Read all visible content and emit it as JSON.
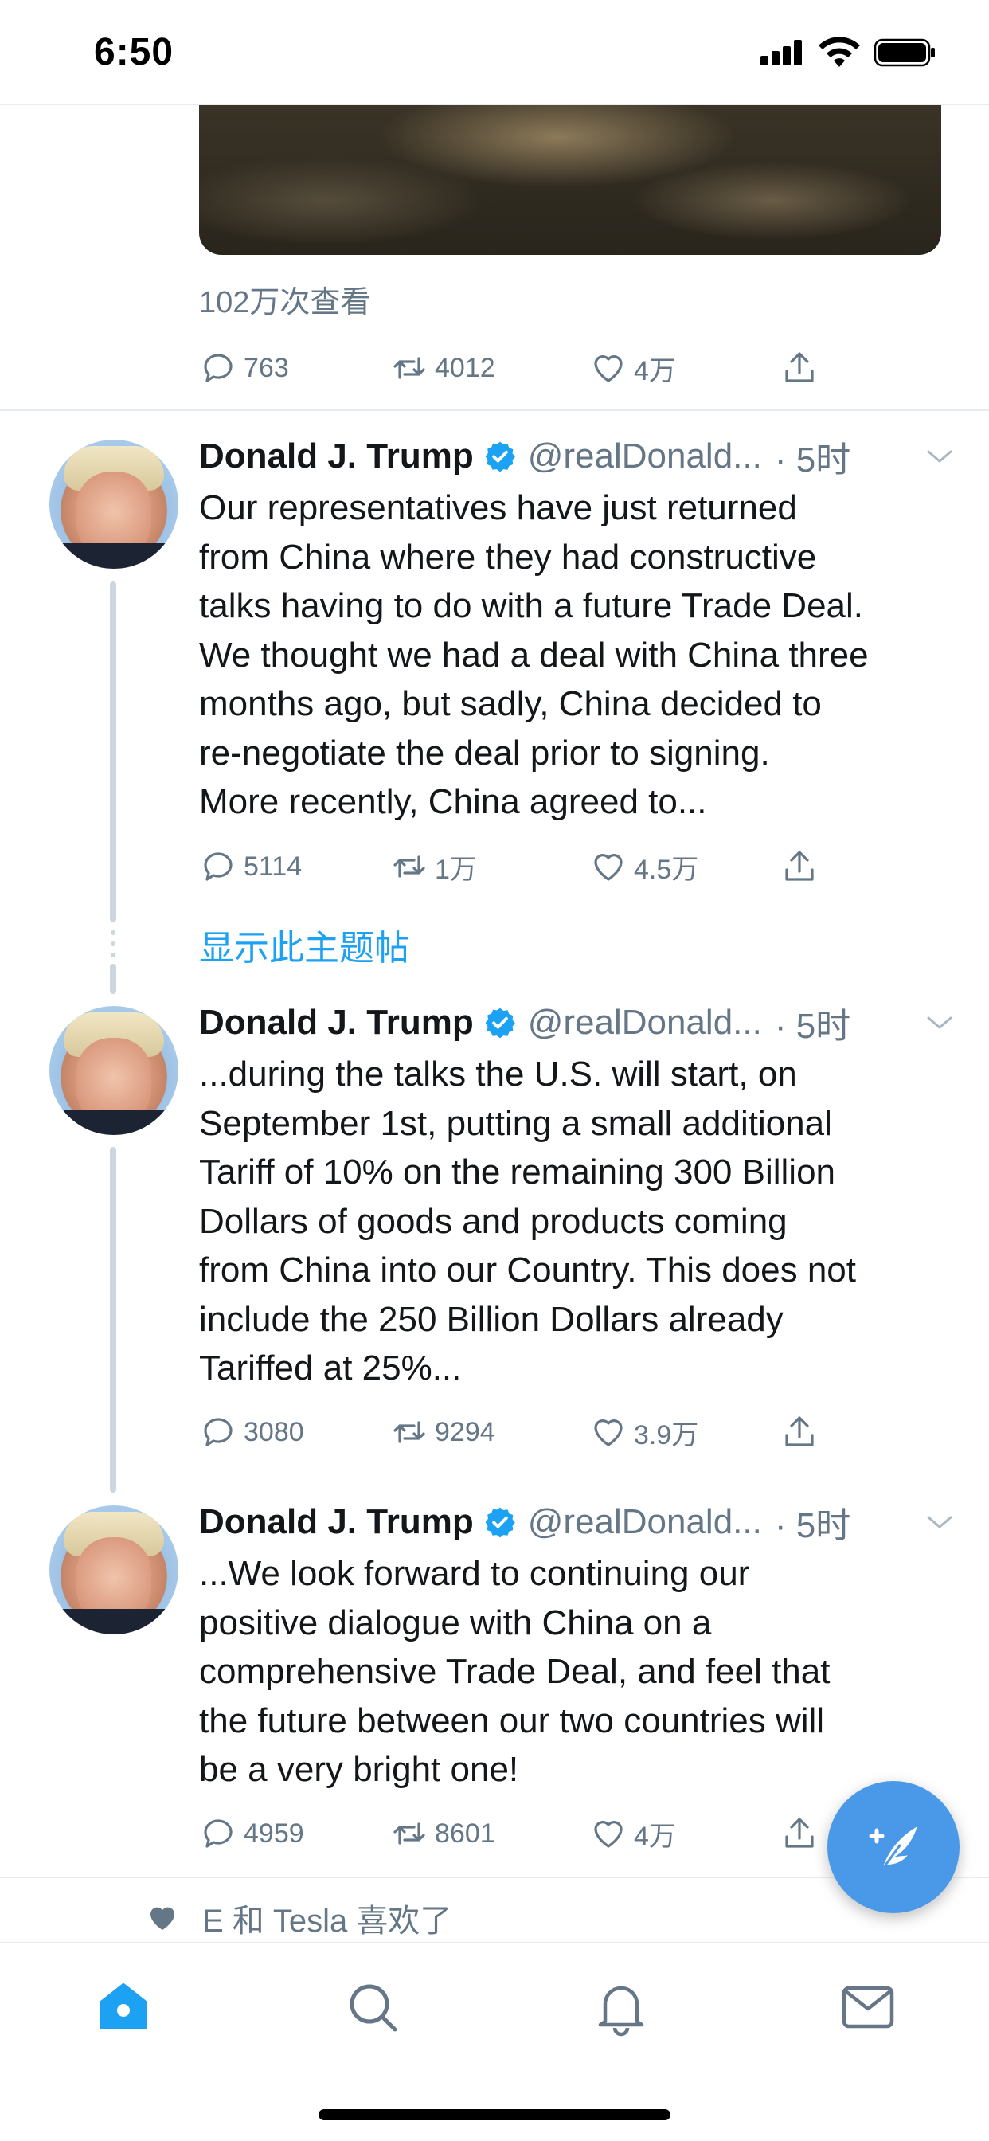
{
  "status_bar": {
    "time": "6:50"
  },
  "previous_tweet": {
    "view_count": "102万次查看",
    "replies": "763",
    "retweets": "4012",
    "likes": "4万"
  },
  "tweets": [
    {
      "name": "Donald J. Trump",
      "handle": "@realDonald...",
      "time": "· 5时",
      "text": "Our representatives have just returned\nfrom China where they had constructive\ntalks having to do with a future Trade Deal.\nWe thought we had a deal with China three\nmonths ago, but sadly, China decided to\nre-negotiate the deal prior to signing.\nMore recently, China agreed to...",
      "replies": "5114",
      "retweets": "1万",
      "likes": "4.5万"
    },
    {
      "name": "Donald J. Trump",
      "handle": "@realDonald...",
      "time": "· 5时",
      "text": "...during the talks the U.S. will start, on\nSeptember 1st, putting a small additional\nTariff of 10% on the remaining 300 Billion\nDollars of goods and products coming\nfrom China into our Country. This does not\ninclude the 250 Billion Dollars already\nTariffed at 25%...",
      "replies": "3080",
      "retweets": "9294",
      "likes": "3.9万"
    },
    {
      "name": "Donald J. Trump",
      "handle": "@realDonald...",
      "time": "· 5时",
      "text": "...We look forward to continuing our\npositive dialogue with China on a\ncomprehensive Trade Deal, and feel that\nthe future between our two countries will\nbe a very bright one!",
      "replies": "4959",
      "retweets": "8601",
      "likes": "4万"
    }
  ],
  "show_thread_label": "显示此主题帖",
  "liked_by": "E 和 Tesla 喜欢了",
  "tab_bar": [
    "home-icon",
    "search-icon",
    "notifications-icon",
    "messages-icon"
  ],
  "colors": {
    "accent": "#1da1f2",
    "fab": "#4a99e9",
    "secondary_text": "#657786",
    "divider": "#e6ecf0"
  }
}
